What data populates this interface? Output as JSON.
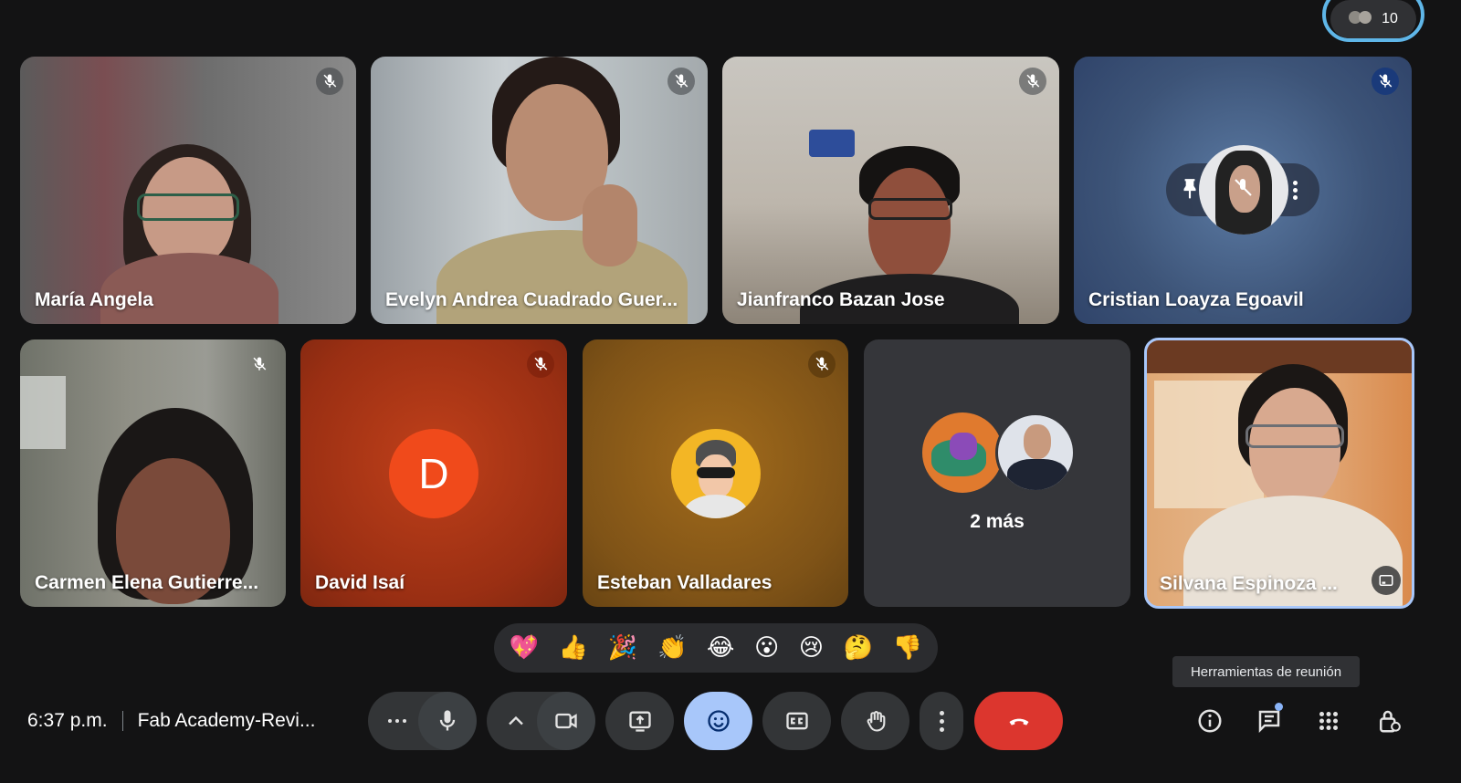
{
  "participants_count": "10",
  "tiles": [
    {
      "name": "María Angela"
    },
    {
      "name": "Evelyn Andrea Cuadrado Guer..."
    },
    {
      "name": "Jianfranco Bazan Jose"
    },
    {
      "name": "Cristian Loayza Egoavil"
    },
    {
      "name": "Carmen Elena Gutierre..."
    },
    {
      "name": "David Isaí",
      "initial": "D"
    },
    {
      "name": "Esteban Valladares"
    },
    {
      "name": "2 más"
    },
    {
      "name": "Silvana Espinoza ..."
    }
  ],
  "reactions": [
    "💖",
    "👍",
    "🎉",
    "👏",
    "😂",
    "😮",
    "😢",
    "🤔",
    "👎"
  ],
  "meeting": {
    "time": "6:37 p.m.",
    "title": "Fab Academy-Revi..."
  },
  "tooltip": "Herramientas de reunión",
  "colors": {
    "background": "#131314",
    "end_call": "#dc362e",
    "active_control": "#a8c7fa",
    "self_border": "#a8c7fa"
  },
  "icons": [
    "more-options-icon",
    "microphone-icon",
    "chevron-up-icon",
    "camera-icon",
    "present-screen-icon",
    "emoji-icon",
    "captions-icon",
    "raise-hand-icon",
    "more-vert-icon",
    "hang-up-icon",
    "info-icon",
    "chat-icon",
    "activities-icon",
    "host-controls-icon"
  ]
}
